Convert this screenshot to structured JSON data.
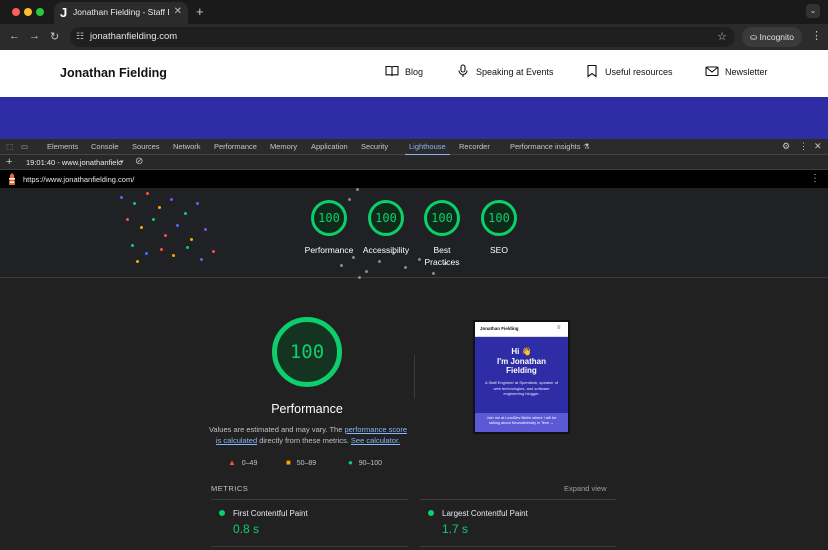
{
  "browser": {
    "tab_title": "Jonathan Fielding - Staff Engi",
    "tab_favicon": "J",
    "url": "jonathanfielding.com",
    "incognito_label": "Incognito"
  },
  "site": {
    "brand": "Jonathan Fielding",
    "nav": [
      {
        "label": "Blog",
        "icon": "book-icon"
      },
      {
        "label": "Speaking at Events",
        "icon": "microphone-icon"
      },
      {
        "label": "Useful resources",
        "icon": "bookmark-icon"
      },
      {
        "label": "Newsletter",
        "icon": "envelope-icon"
      }
    ],
    "banner_color": "#2f2da6"
  },
  "devtools": {
    "tabs": [
      "Elements",
      "Console",
      "Sources",
      "Network",
      "Performance",
      "Memory",
      "Application",
      "Security",
      "Lighthouse",
      "Recorder",
      "Performance insights"
    ],
    "active_tab": "Lighthouse",
    "report_select": "19:01:40 - www.jonathanfielc",
    "report_url": "https://www.jonathanfielding.com/"
  },
  "lighthouse": {
    "gauges": [
      {
        "score": "100",
        "label": "Performance"
      },
      {
        "score": "100",
        "label": "Accessibility"
      },
      {
        "score": "100",
        "label": "Best Practices"
      },
      {
        "score": "100",
        "label": "SEO"
      }
    ],
    "main_score": "100",
    "main_title": "Performance",
    "desc_prefix": "Values are estimated and may vary. The ",
    "desc_link1": "performance score is calculated",
    "desc_mid": " directly from these metrics. ",
    "desc_link2": "See calculator.",
    "legend": [
      {
        "range": "0–49",
        "color": "#ff4e42"
      },
      {
        "range": "50–89",
        "color": "#ffa400"
      },
      {
        "range": "90–100",
        "color": "#0cce6b"
      }
    ],
    "metrics_heading": "METRICS",
    "expand_label": "Expand view",
    "metrics": [
      {
        "name": "First Contentful Paint",
        "value": "0.8 s"
      },
      {
        "name": "Largest Contentful Paint",
        "value": "1.7 s"
      }
    ],
    "screenshot": {
      "brand": "Jonathan Fielding",
      "hi": "Hi 👋",
      "heading": "I'm Jonathan Fielding",
      "body": "A Staff Engineer at Spendesk, speaker of web technologies, and software engineering blogger.",
      "footer": "Join me at LeadDev Berlin where I will be talking about Neurodiversity in Tech →"
    }
  }
}
